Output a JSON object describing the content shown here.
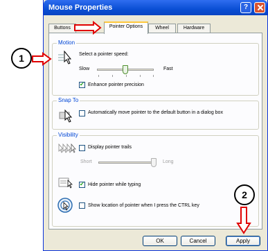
{
  "window": {
    "title": "Mouse Properties",
    "help": "?"
  },
  "tabs": [
    {
      "label": "Buttons"
    },
    {
      "label": "Pointer Options",
      "active": true
    },
    {
      "label": "Wheel"
    },
    {
      "label": "Hardware"
    }
  ],
  "motion": {
    "title": "Motion",
    "speed_label": "Select a pointer speed:",
    "slow": "Slow",
    "fast": "Fast",
    "speed_level": 0.5,
    "precision_label": "Enhance pointer precision",
    "precision_checked": true
  },
  "snap_to": {
    "title": "Snap To",
    "label": "Automatically move pointer to the default button in a dialog box",
    "checked": false
  },
  "visibility": {
    "title": "Visibility",
    "trails_label": "Display pointer trails",
    "trails_checked": false,
    "short": "Short",
    "long": "Long",
    "trails_level": 1.0,
    "hide_label": "Hide pointer while typing",
    "hide_checked": true,
    "ctrl_label": "Show location of pointer when I press the CTRL key",
    "ctrl_checked": false
  },
  "buttons": {
    "ok": "OK",
    "cancel": "Cancel",
    "apply": "Apply"
  },
  "callouts": {
    "one": "1",
    "two": "2"
  },
  "colors": {
    "arrow": "#e00000",
    "title_bar": "#0a4fd4",
    "group_title": "#0046d5"
  }
}
